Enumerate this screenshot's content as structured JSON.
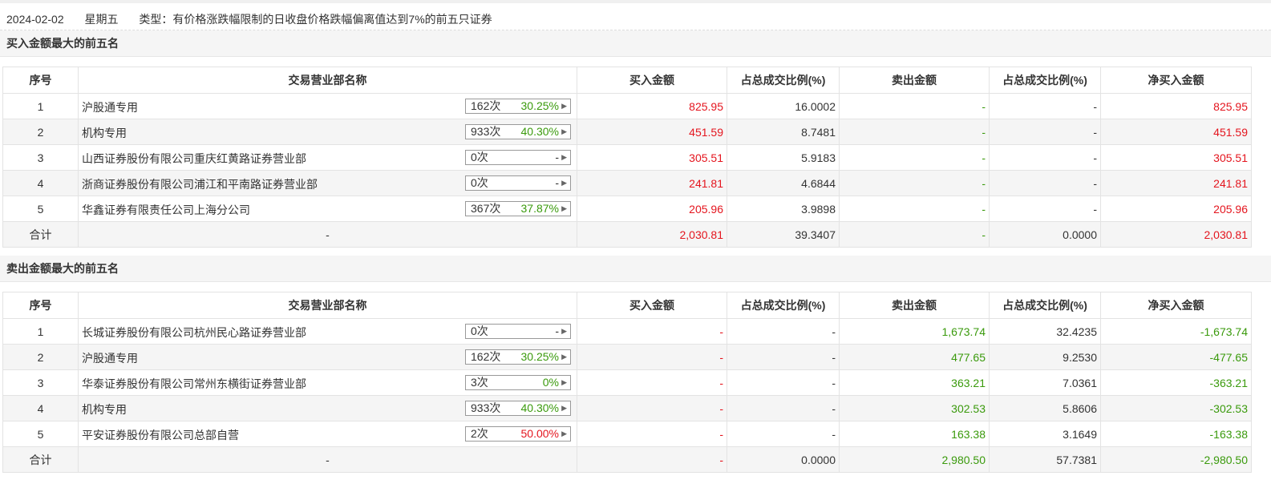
{
  "header": {
    "date": "2024-02-02",
    "weekday": "星期五",
    "type_label": "类型：有价格涨跌幅限制的日收盘价格跌幅偏离值达到7%的前五只证券"
  },
  "columns": [
    "序号",
    "交易营业部名称",
    "买入金额",
    "占总成交比例(%)",
    "卖出金额",
    "占总成交比例(%)",
    "净买入金额"
  ],
  "buy_section": {
    "title": "买入金额最大的前五名",
    "rows": [
      {
        "idx": "1",
        "name": "沪股通专用",
        "count": "162次",
        "pct": "30.25%",
        "buy": "825.95",
        "buy_ratio": "16.0002",
        "sell": "-",
        "sell_ratio": "-",
        "net": "825.95"
      },
      {
        "idx": "2",
        "name": "机构专用",
        "count": "933次",
        "pct": "40.30%",
        "buy": "451.59",
        "buy_ratio": "8.7481",
        "sell": "-",
        "sell_ratio": "-",
        "net": "451.59"
      },
      {
        "idx": "3",
        "name": "山西证券股份有限公司重庆红黄路证券营业部",
        "count": "0次",
        "pct": "-",
        "buy": "305.51",
        "buy_ratio": "5.9183",
        "sell": "-",
        "sell_ratio": "-",
        "net": "305.51"
      },
      {
        "idx": "4",
        "name": "浙商证券股份有限公司浦江和平南路证券营业部",
        "count": "0次",
        "pct": "-",
        "buy": "241.81",
        "buy_ratio": "4.6844",
        "sell": "-",
        "sell_ratio": "-",
        "net": "241.81"
      },
      {
        "idx": "5",
        "name": "华鑫证券有限责任公司上海分公司",
        "count": "367次",
        "pct": "37.87%",
        "buy": "205.96",
        "buy_ratio": "3.9898",
        "sell": "-",
        "sell_ratio": "-",
        "net": "205.96"
      }
    ],
    "total": {
      "label": "合计",
      "name": "-",
      "buy": "2,030.81",
      "buy_ratio": "39.3407",
      "sell": "-",
      "sell_ratio": "0.0000",
      "net": "2,030.81"
    }
  },
  "sell_section": {
    "title": "卖出金额最大的前五名",
    "rows": [
      {
        "idx": "1",
        "name": "长城证券股份有限公司杭州民心路证券营业部",
        "count": "0次",
        "pct": "-",
        "buy": "-",
        "buy_ratio": "-",
        "sell": "1,673.74",
        "sell_ratio": "32.4235",
        "net": "-1,673.74"
      },
      {
        "idx": "2",
        "name": "沪股通专用",
        "count": "162次",
        "pct": "30.25%",
        "buy": "-",
        "buy_ratio": "-",
        "sell": "477.65",
        "sell_ratio": "9.2530",
        "net": "-477.65"
      },
      {
        "idx": "3",
        "name": "华泰证券股份有限公司常州东横街证券营业部",
        "count": "3次",
        "pct": "0%",
        "buy": "-",
        "buy_ratio": "-",
        "sell": "363.21",
        "sell_ratio": "7.0361",
        "net": "-363.21"
      },
      {
        "idx": "4",
        "name": "机构专用",
        "count": "933次",
        "pct": "40.30%",
        "buy": "-",
        "buy_ratio": "-",
        "sell": "302.53",
        "sell_ratio": "5.8606",
        "net": "-302.53"
      },
      {
        "idx": "5",
        "name": "平安证券股份有限公司总部自营",
        "count": "2次",
        "pct": "50.00%",
        "buy": "-",
        "buy_ratio": "-",
        "sell": "163.38",
        "sell_ratio": "3.1649",
        "net": "-163.38"
      }
    ],
    "total": {
      "label": "合计",
      "name": "-",
      "buy": "-",
      "buy_ratio": "0.0000",
      "sell": "2,980.50",
      "sell_ratio": "57.7381",
      "net": "-2,980.50"
    }
  },
  "pct_colors": {
    "30.25%": "#3a9a0c",
    "40.30%": "#3a9a0c",
    "37.87%": "#3a9a0c",
    "0%": "#3a9a0c",
    "50.00%": "#e4151e",
    "-": "#333333"
  }
}
